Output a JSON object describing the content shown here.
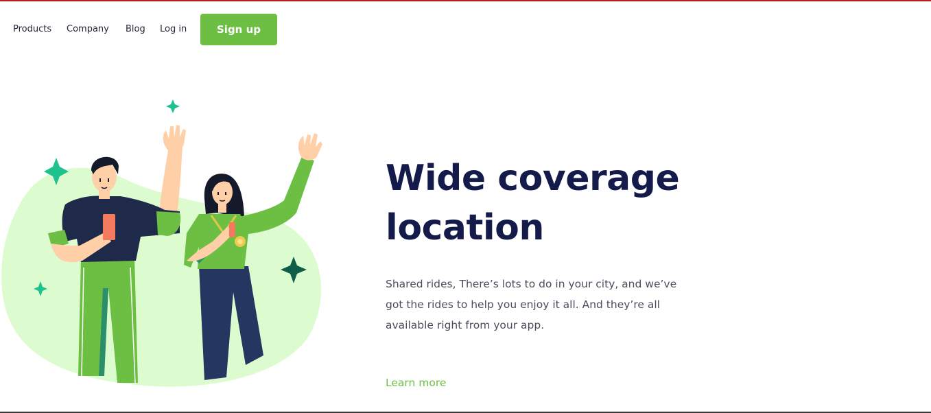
{
  "nav": {
    "products": "Products",
    "company": "Company",
    "blog": "Blog",
    "login": "Log in",
    "signup": "Sign up"
  },
  "hero": {
    "title_line1": "Wide coverage",
    "title_line2": "location",
    "description": "Shared rides, There’s lots to do in your city, and we’ve got the rides to help you enjoy it all. And they’re all available right from your app.",
    "cta": "Learn more"
  },
  "colors": {
    "accent_green": "#6cbf43",
    "title_navy": "#141a4a",
    "blob_green": "#dcfcd0",
    "sparkle_teal": "#1fc28f",
    "sparkle_dark": "#0f5e47"
  },
  "icons": [
    "sparkle-icon",
    "phone-icon",
    "medal-icon"
  ]
}
